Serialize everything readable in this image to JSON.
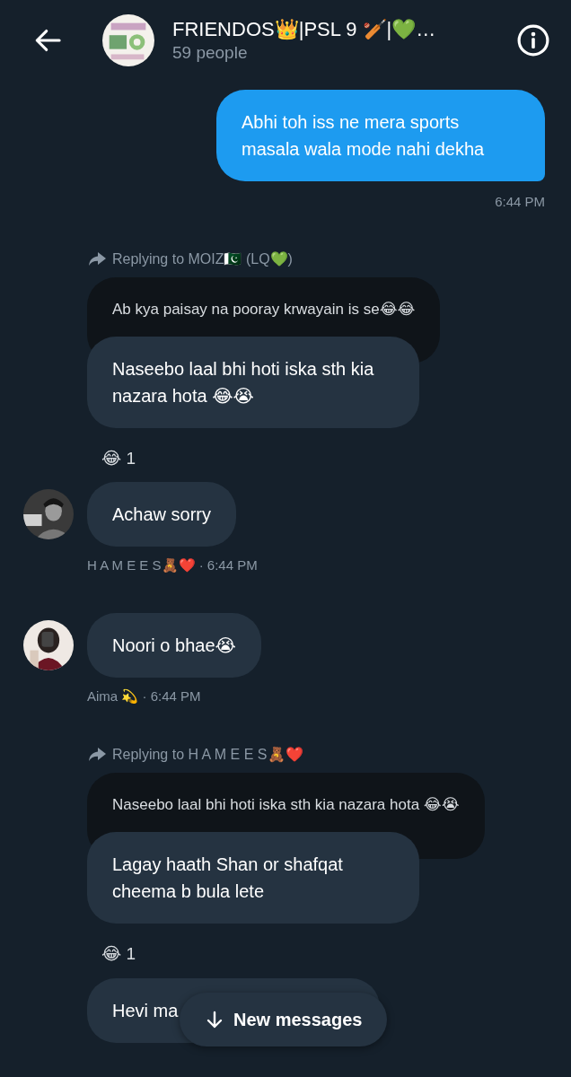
{
  "header": {
    "title": "FRIENDOS👑|PSL 9 🏏|💚…",
    "subtitle": "59 people"
  },
  "messages": [
    {
      "kind": "sent",
      "text": "Abhi toh iss ne mera sports masala wala mode nahi dekha",
      "time": "6:44 PM"
    },
    {
      "kind": "reply",
      "replying_to": "Replying to MOIZ🇵🇰 (LQ💚)",
      "quoted": "Ab kya paisay na pooray krwayain is se😂😂",
      "text": "Naseebo laal bhi hoti iska sth kia nazara hota 😂😭",
      "reactions": [
        {
          "emoji": "😂",
          "count": "1"
        }
      ]
    },
    {
      "kind": "received",
      "text": "Achaw sorry",
      "meta": "H A M E E S🧸❤️ · 6:44 PM"
    },
    {
      "kind": "received",
      "text": "Noori o bhae😭",
      "meta": "Aima 💫 · 6:44 PM"
    },
    {
      "kind": "reply",
      "replying_to": "Replying to H A M E E S🧸❤️",
      "quoted": "Naseebo laal bhi hoti iska sth kia nazara hota 😂😭",
      "text": "Lagay haath Shan or shafqat cheema b bula lete",
      "reactions": [
        {
          "emoji": "😂",
          "count": "1"
        }
      ]
    },
    {
      "kind": "plain",
      "text": "Hevi ma"
    }
  ],
  "new_messages_button": {
    "label": "New messages"
  }
}
